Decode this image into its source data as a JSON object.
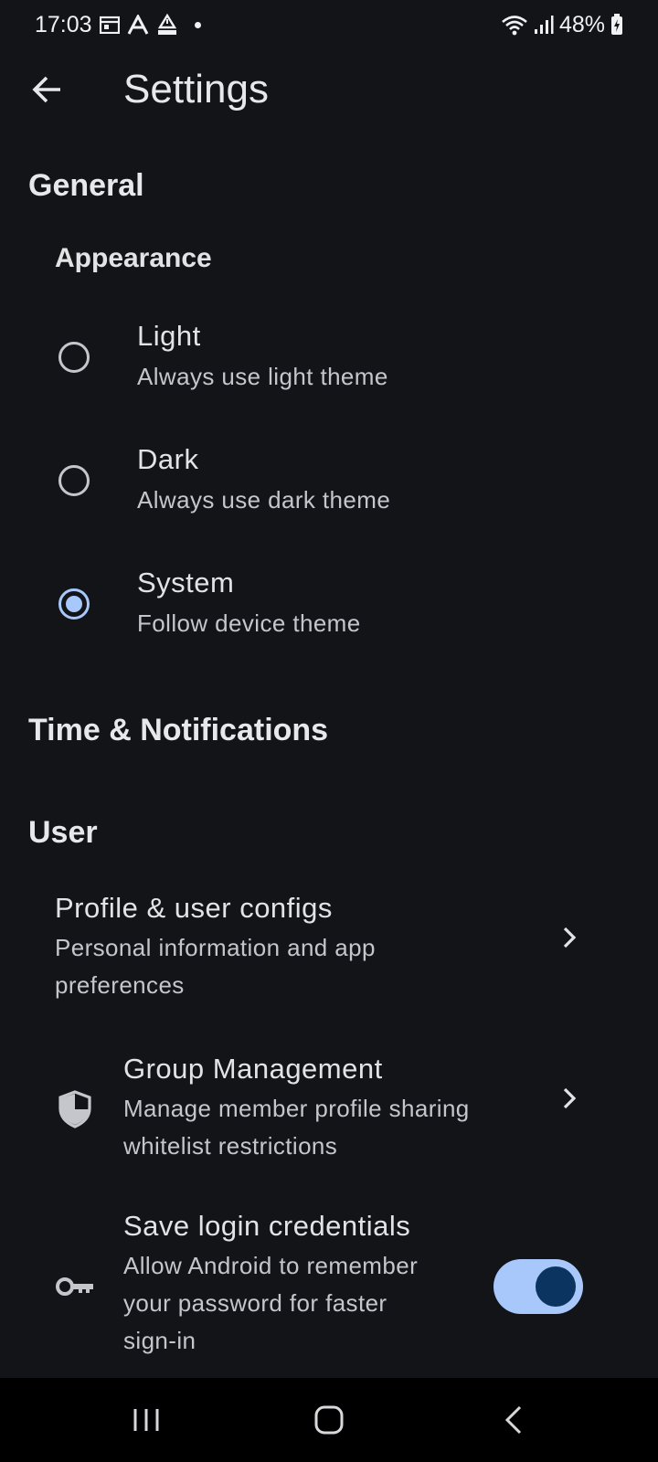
{
  "status_bar": {
    "time": "17:03",
    "battery": "48%",
    "icons": [
      "calendar-icon",
      "a-letter-icon",
      "mm-warning-icon",
      "dot-icon",
      "wifi-icon",
      "signal-icon",
      "battery-icon"
    ]
  },
  "app_bar": {
    "title": "Settings",
    "back_icon": "arrow-left-icon"
  },
  "general": {
    "title": "General",
    "appearance": {
      "title": "Appearance",
      "options": [
        {
          "label": "Light",
          "description": "Always use light theme",
          "selected": false
        },
        {
          "label": "Dark",
          "description": "Always use dark theme",
          "selected": false
        },
        {
          "label": "System",
          "description": "Follow device theme",
          "selected": true
        }
      ]
    }
  },
  "time_notifications": {
    "title": "Time & Notifications"
  },
  "user": {
    "title": "User",
    "profile": {
      "title": "Profile & user configs",
      "description_line1": "Personal information and app",
      "description_line2": "preferences"
    },
    "group": {
      "title": "Group Management",
      "description_line1": "Manage member profile sharing",
      "description_line2": "whitelist restrictions",
      "icon": "shield-icon"
    },
    "credentials": {
      "title": "Save login credentials",
      "description_line1": "Allow Android to remember",
      "description_line2": "your password for faster",
      "description_line3": "sign-in",
      "icon": "key-icon",
      "enabled": true
    }
  },
  "colors": {
    "background": "#121418",
    "accent": "#a8c7fa",
    "toggle_thumb": "#0b3560"
  }
}
